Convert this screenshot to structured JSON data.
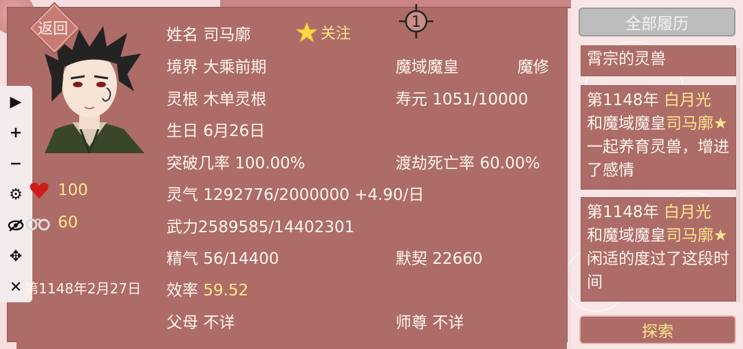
{
  "back_label": "返回",
  "follow_label": "关注",
  "character": {
    "name_label": "姓名",
    "name": "司马廓",
    "realm_label": "境界",
    "realm": "大乘前期",
    "title": "魔域魔皇",
    "faction": "魔修",
    "root_label": "灵根",
    "root": "木单灵根",
    "lifespan_label": "寿元",
    "lifespan": "1051/10000",
    "birthday_label": "生日",
    "birthday": "6月26日",
    "breakthrough_label": "突破几率",
    "breakthrough": "100.00%",
    "tribulation_label": "渡劫死亡率",
    "tribulation": "60.00%",
    "spirit_label": "灵气",
    "spirit": "1292776/2000000 +4.90/日",
    "force_label": "武力",
    "force": "2589585/14402301",
    "essence_label": "精气",
    "essence": "56/14400",
    "tacit_label": "默契",
    "tacit": "22660",
    "efficiency_label": "效率",
    "efficiency": "59.52",
    "parents_label": "父母",
    "parents": "不详",
    "master_label": "师尊",
    "master": "不详"
  },
  "stats": {
    "favor": "100",
    "bond": "60"
  },
  "date": "第1148年2月27日",
  "target_number": "1",
  "right": {
    "all_history_label": "全部履历",
    "top_fragment": "霄宗的灵兽",
    "events": [
      {
        "year": "第1148年",
        "who": "白月光",
        "connector": "和魔域魔皇",
        "partner": "司马廓★",
        "text": "一起养育灵兽，增进了感情"
      },
      {
        "year": "第1148年",
        "who": "白月光",
        "connector": "和魔域魔皇",
        "partner": "司马廓★",
        "text": "闲适的度过了这段时间"
      }
    ],
    "explore_label": "探索"
  },
  "colors": {
    "panel": "#ad6c68",
    "highlight_text": "#ffe68a",
    "text": "#fff6ee"
  }
}
